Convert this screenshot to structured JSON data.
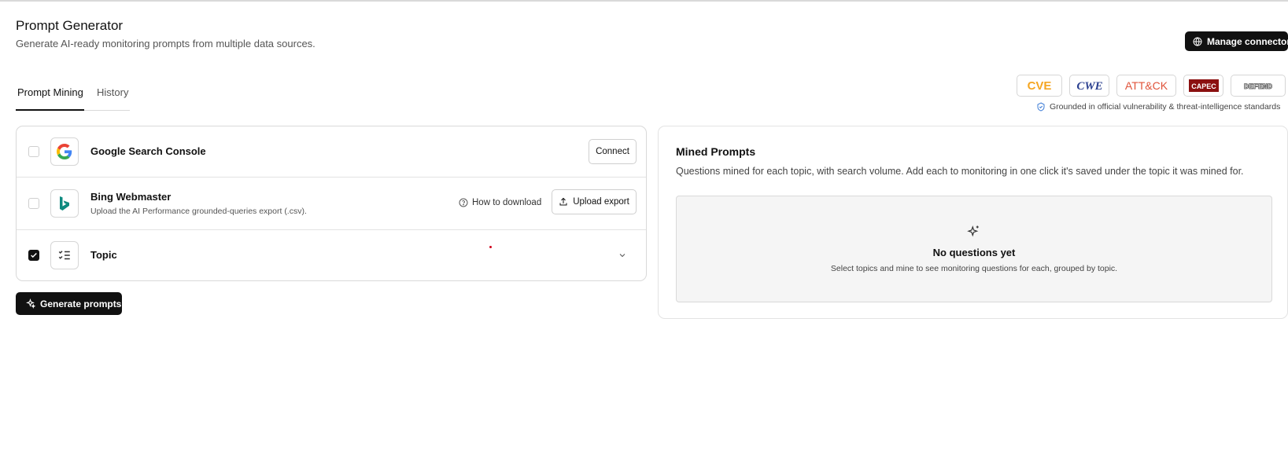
{
  "header": {
    "title": "Prompt Generator",
    "subtitle": "Generate AI-ready monitoring prompts from multiple data sources.",
    "manage_connectors_label": "Manage connectors"
  },
  "tabs": [
    {
      "label": "Prompt Mining",
      "active": true
    },
    {
      "label": "History",
      "active": false
    }
  ],
  "standards": {
    "badges": [
      "CVE",
      "CWE",
      "ATT&CK",
      "CAPEC",
      "DEFEND"
    ],
    "note": "Grounded in official vulnerability & threat-intelligence standards"
  },
  "sources": [
    {
      "name": "Google Search Console",
      "description": "",
      "checked": false,
      "action_label": "Connect"
    },
    {
      "name": "Bing Webmaster",
      "description": "Upload the AI Performance grounded-queries export (.csv).",
      "checked": false,
      "help_label": "How to download",
      "action_label": "Upload export"
    },
    {
      "name": "Topic",
      "description": "",
      "checked": true
    }
  ],
  "generate_label": "Generate prompts",
  "mined": {
    "title": "Mined Prompts",
    "description": "Questions mined for each topic, with search volume. Add each to monitoring in one click it's saved under the topic it was mined for.",
    "empty_title": "No questions yet",
    "empty_description": "Select topics and mine to see monitoring questions for each, grouped by topic."
  },
  "colors": {
    "primary": "#111111",
    "cve_orange": "#f5a623",
    "attck_red": "#e0533a",
    "capec_maroon": "#8b1010",
    "bing_teal": "#0d8a7f"
  }
}
